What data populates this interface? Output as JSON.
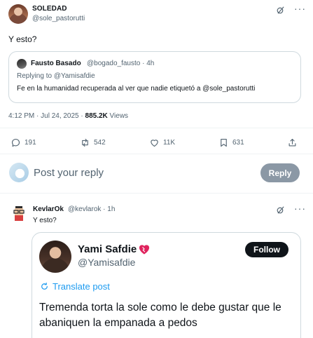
{
  "main_tweet": {
    "display_name": "SOLEDAD",
    "handle": "@sole_pastorutti",
    "text": "Y esto?",
    "more_icon": "more-horizontal-icon",
    "grok_icon": "grok-icon"
  },
  "quote": {
    "display_name": "Fausto Basado",
    "handle_time": "@bogado_fausto · 4h",
    "replying_prefix": "Replying to ",
    "replying_to": "@Yamisafdie",
    "text": "Fe en la humanidad recuperada al ver que nadie etiquetó a @sole_pastorutti"
  },
  "meta": {
    "timestamp": "4:12 PM · Jul 24, 2025 · ",
    "views_count": "885.2K",
    "views_label": " Views"
  },
  "actions": {
    "replies": "191",
    "reposts": "542",
    "likes": "11K",
    "bookmarks": "631"
  },
  "composer": {
    "placeholder": "Post your reply",
    "reply_button": "Reply"
  },
  "reply_tweet": {
    "display_name": "KevlarOk",
    "handle_time": "@kevlarok · 1h",
    "text": "Y esto?"
  },
  "embedded": {
    "display_name": "Yami Safdie",
    "handle": "@Yamisafdie",
    "follow_button": "Follow",
    "translate": "Translate post",
    "text": "Tremenda torta la sole como le debe gustar que le abaniquen la empanada a pedos"
  },
  "colors": {
    "accent": "#1d9bf0",
    "muted": "#536471",
    "border": "#cfd9de",
    "reply_button": "#8b98a5"
  }
}
